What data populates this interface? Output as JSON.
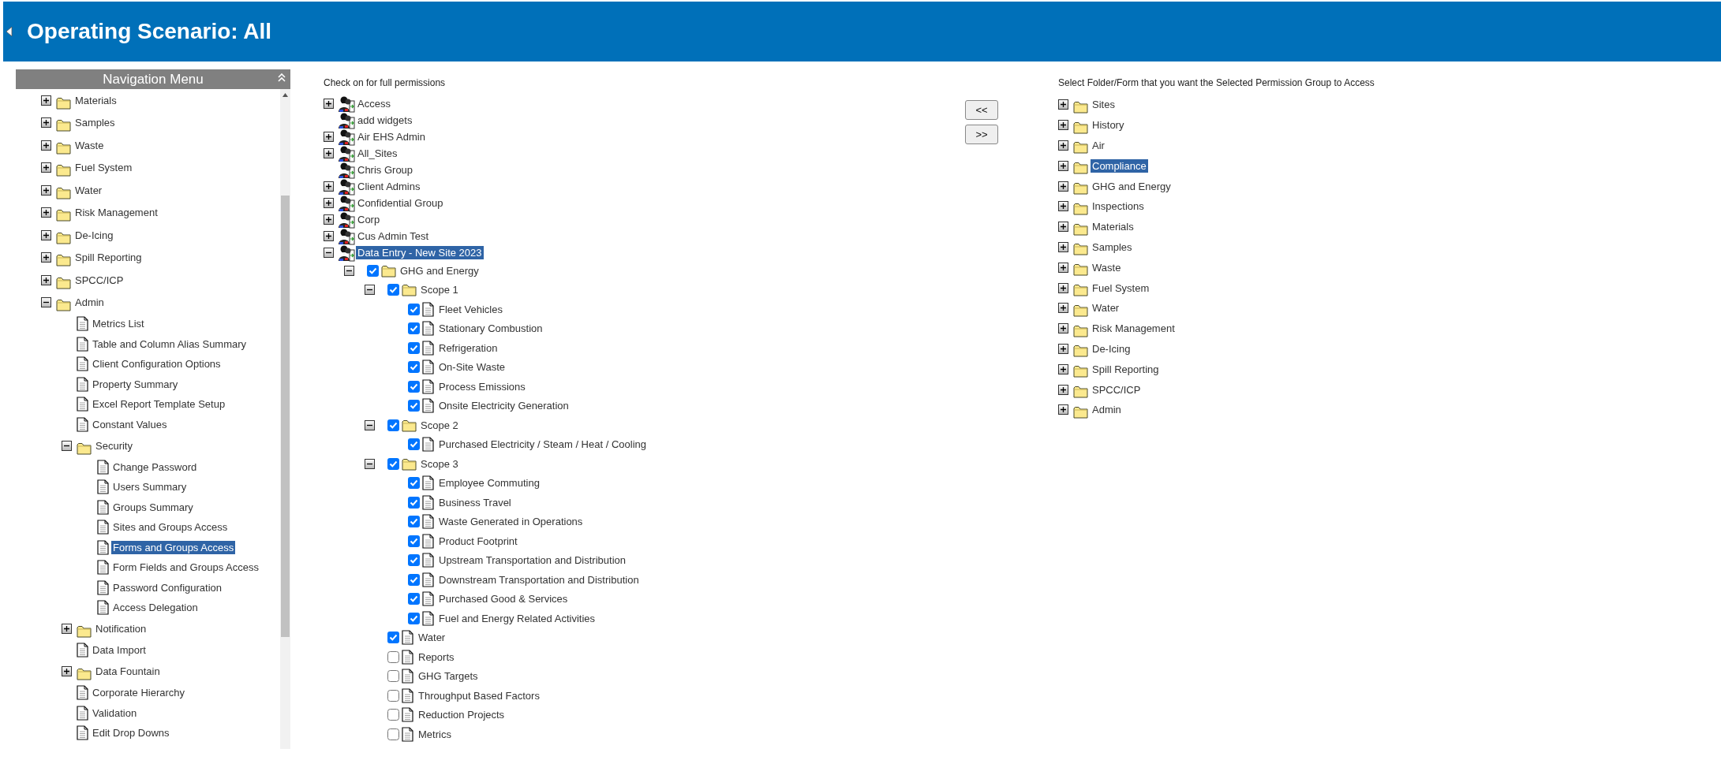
{
  "header": {
    "title": "Operating Scenario: All"
  },
  "navigation": {
    "title": "Navigation Menu",
    "items": [
      {
        "label": "Materials",
        "kind": "folder",
        "expanded": false,
        "selected": false
      },
      {
        "label": "Samples",
        "kind": "folder",
        "expanded": false,
        "selected": false
      },
      {
        "label": "Waste",
        "kind": "folder",
        "expanded": false,
        "selected": false
      },
      {
        "label": "Fuel System",
        "kind": "folder",
        "expanded": false,
        "selected": false
      },
      {
        "label": "Water",
        "kind": "folder",
        "expanded": false,
        "selected": false
      },
      {
        "label": "Risk Management",
        "kind": "folder",
        "expanded": false,
        "selected": false
      },
      {
        "label": "De-Icing",
        "kind": "folder",
        "expanded": false,
        "selected": false
      },
      {
        "label": "Spill Reporting",
        "kind": "folder",
        "expanded": false,
        "selected": false
      },
      {
        "label": "SPCC/ICP",
        "kind": "folder",
        "expanded": false,
        "selected": false
      },
      {
        "label": "Admin",
        "kind": "folder",
        "expanded": true,
        "selected": false,
        "children": [
          {
            "label": "Metrics List",
            "kind": "form",
            "selected": false
          },
          {
            "label": "Table and Column Alias Summary",
            "kind": "form",
            "selected": false
          },
          {
            "label": "Client Configuration Options",
            "kind": "form",
            "selected": false
          },
          {
            "label": "Property Summary",
            "kind": "form",
            "selected": false
          },
          {
            "label": "Excel Report Template Setup",
            "kind": "form",
            "selected": false
          },
          {
            "label": "Constant Values",
            "kind": "form",
            "selected": false
          },
          {
            "label": "Security",
            "kind": "folder",
            "expanded": true,
            "selected": false,
            "children": [
              {
                "label": "Change Password",
                "kind": "form",
                "selected": false
              },
              {
                "label": "Users Summary",
                "kind": "form",
                "selected": false
              },
              {
                "label": "Groups Summary",
                "kind": "form",
                "selected": false
              },
              {
                "label": "Sites and Groups Access",
                "kind": "form",
                "selected": false
              },
              {
                "label": "Forms and Groups Access",
                "kind": "form",
                "selected": true
              },
              {
                "label": "Form Fields and Groups Access",
                "kind": "form",
                "selected": false
              },
              {
                "label": "Password Configuration",
                "kind": "form",
                "selected": false
              },
              {
                "label": "Access Delegation",
                "kind": "form",
                "selected": false
              }
            ]
          },
          {
            "label": "Notification",
            "kind": "folder",
            "expanded": false,
            "selected": false
          },
          {
            "label": "Data Import",
            "kind": "form",
            "selected": false
          },
          {
            "label": "Data Fountain",
            "kind": "folder",
            "expanded": false,
            "selected": false
          },
          {
            "label": "Corporate Hierarchy",
            "kind": "form",
            "selected": false
          },
          {
            "label": "Validation",
            "kind": "form",
            "selected": false
          },
          {
            "label": "Edit Drop Downs",
            "kind": "form",
            "selected": false
          }
        ]
      }
    ]
  },
  "permissions": {
    "caption": "Check on for full permissions",
    "groups": [
      {
        "label": "Access",
        "kind": "group",
        "expanded": false,
        "selected": false
      },
      {
        "label": "add widgets",
        "kind": "group",
        "selected": false
      },
      {
        "label": "Air EHS Admin",
        "kind": "group",
        "expanded": false,
        "selected": false
      },
      {
        "label": "All_Sites",
        "kind": "group",
        "expanded": false,
        "selected": false
      },
      {
        "label": "Chris Group",
        "kind": "group",
        "selected": false
      },
      {
        "label": "Client Admins",
        "kind": "group",
        "expanded": false,
        "selected": false
      },
      {
        "label": "Confidential Group",
        "kind": "group",
        "expanded": false,
        "selected": false
      },
      {
        "label": "Corp",
        "kind": "group",
        "expanded": false,
        "selected": false
      },
      {
        "label": "Cus Admin Test",
        "kind": "group",
        "expanded": false,
        "selected": false
      },
      {
        "label": "Data Entry - New Site 2023",
        "kind": "group",
        "expanded": true,
        "selected": true,
        "children": [
          {
            "label": "GHG and Energy",
            "kind": "folder",
            "expanded": true,
            "checked": true,
            "children": [
              {
                "label": "Scope 1",
                "kind": "folder",
                "expanded": true,
                "checked": true,
                "children": [
                  {
                    "label": "Fleet Vehicles",
                    "kind": "form",
                    "checked": true
                  },
                  {
                    "label": "Stationary Combustion",
                    "kind": "form",
                    "checked": true
                  },
                  {
                    "label": "Refrigeration",
                    "kind": "form",
                    "checked": true
                  },
                  {
                    "label": "On-Site Waste",
                    "kind": "form",
                    "checked": true
                  },
                  {
                    "label": "Process Emissions",
                    "kind": "form",
                    "checked": true
                  },
                  {
                    "label": "Onsite Electricity Generation",
                    "kind": "form",
                    "checked": true
                  }
                ]
              },
              {
                "label": "Scope 2",
                "kind": "folder",
                "expanded": true,
                "checked": true,
                "children": [
                  {
                    "label": "Purchased Electricity / Steam / Heat / Cooling",
                    "kind": "form",
                    "checked": true
                  }
                ]
              },
              {
                "label": "Scope 3",
                "kind": "folder",
                "expanded": true,
                "checked": true,
                "children": [
                  {
                    "label": "Employee Commuting",
                    "kind": "form",
                    "checked": true
                  },
                  {
                    "label": "Business Travel",
                    "kind": "form",
                    "checked": true
                  },
                  {
                    "label": "Waste Generated in Operations",
                    "kind": "form",
                    "checked": true
                  },
                  {
                    "label": "Product Footprint",
                    "kind": "form",
                    "checked": true
                  },
                  {
                    "label": "Upstream Transportation and Distribution",
                    "kind": "form",
                    "checked": true
                  },
                  {
                    "label": "Downstream Transportation and Distribution",
                    "kind": "form",
                    "checked": true
                  },
                  {
                    "label": "Purchased Good & Services",
                    "kind": "form",
                    "checked": true
                  },
                  {
                    "label": "Fuel and Energy Related Activities",
                    "kind": "form",
                    "checked": true
                  }
                ]
              },
              {
                "label": "Water",
                "kind": "form",
                "checked": true
              },
              {
                "label": "Reports",
                "kind": "form",
                "checked": false
              },
              {
                "label": "GHG Targets",
                "kind": "form",
                "checked": false
              },
              {
                "label": "Throughput Based Factors",
                "kind": "form",
                "checked": false
              },
              {
                "label": "Reduction Projects",
                "kind": "form",
                "checked": false
              },
              {
                "label": "Metrics",
                "kind": "form",
                "checked": false
              }
            ]
          }
        ]
      }
    ]
  },
  "transfer_buttons": [
    "<<",
    ">>"
  ],
  "access_tree": {
    "caption": "Select Folder/Form that you want the Selected Permission Group to Access",
    "items": [
      {
        "label": "Sites",
        "kind": "folder",
        "expanded": false,
        "selected": false
      },
      {
        "label": "History",
        "kind": "folder",
        "expanded": false,
        "selected": false
      },
      {
        "label": "Air",
        "kind": "folder",
        "expanded": false,
        "selected": false
      },
      {
        "label": "Compliance",
        "kind": "folder",
        "expanded": false,
        "selected": true
      },
      {
        "label": "GHG and Energy",
        "kind": "folder",
        "expanded": false,
        "selected": false
      },
      {
        "label": "Inspections",
        "kind": "folder",
        "expanded": false,
        "selected": false
      },
      {
        "label": "Materials",
        "kind": "folder",
        "expanded": false,
        "selected": false
      },
      {
        "label": "Samples",
        "kind": "folder",
        "expanded": false,
        "selected": false
      },
      {
        "label": "Waste",
        "kind": "folder",
        "expanded": false,
        "selected": false
      },
      {
        "label": "Fuel System",
        "kind": "folder",
        "expanded": false,
        "selected": false
      },
      {
        "label": "Water",
        "kind": "folder",
        "expanded": false,
        "selected": false
      },
      {
        "label": "Risk Management",
        "kind": "folder",
        "expanded": false,
        "selected": false
      },
      {
        "label": "De-Icing",
        "kind": "folder",
        "expanded": false,
        "selected": false
      },
      {
        "label": "Spill Reporting",
        "kind": "folder",
        "expanded": false,
        "selected": false
      },
      {
        "label": "SPCC/ICP",
        "kind": "folder",
        "expanded": false,
        "selected": false
      },
      {
        "label": "Admin",
        "kind": "folder",
        "expanded": false,
        "selected": false
      }
    ]
  }
}
